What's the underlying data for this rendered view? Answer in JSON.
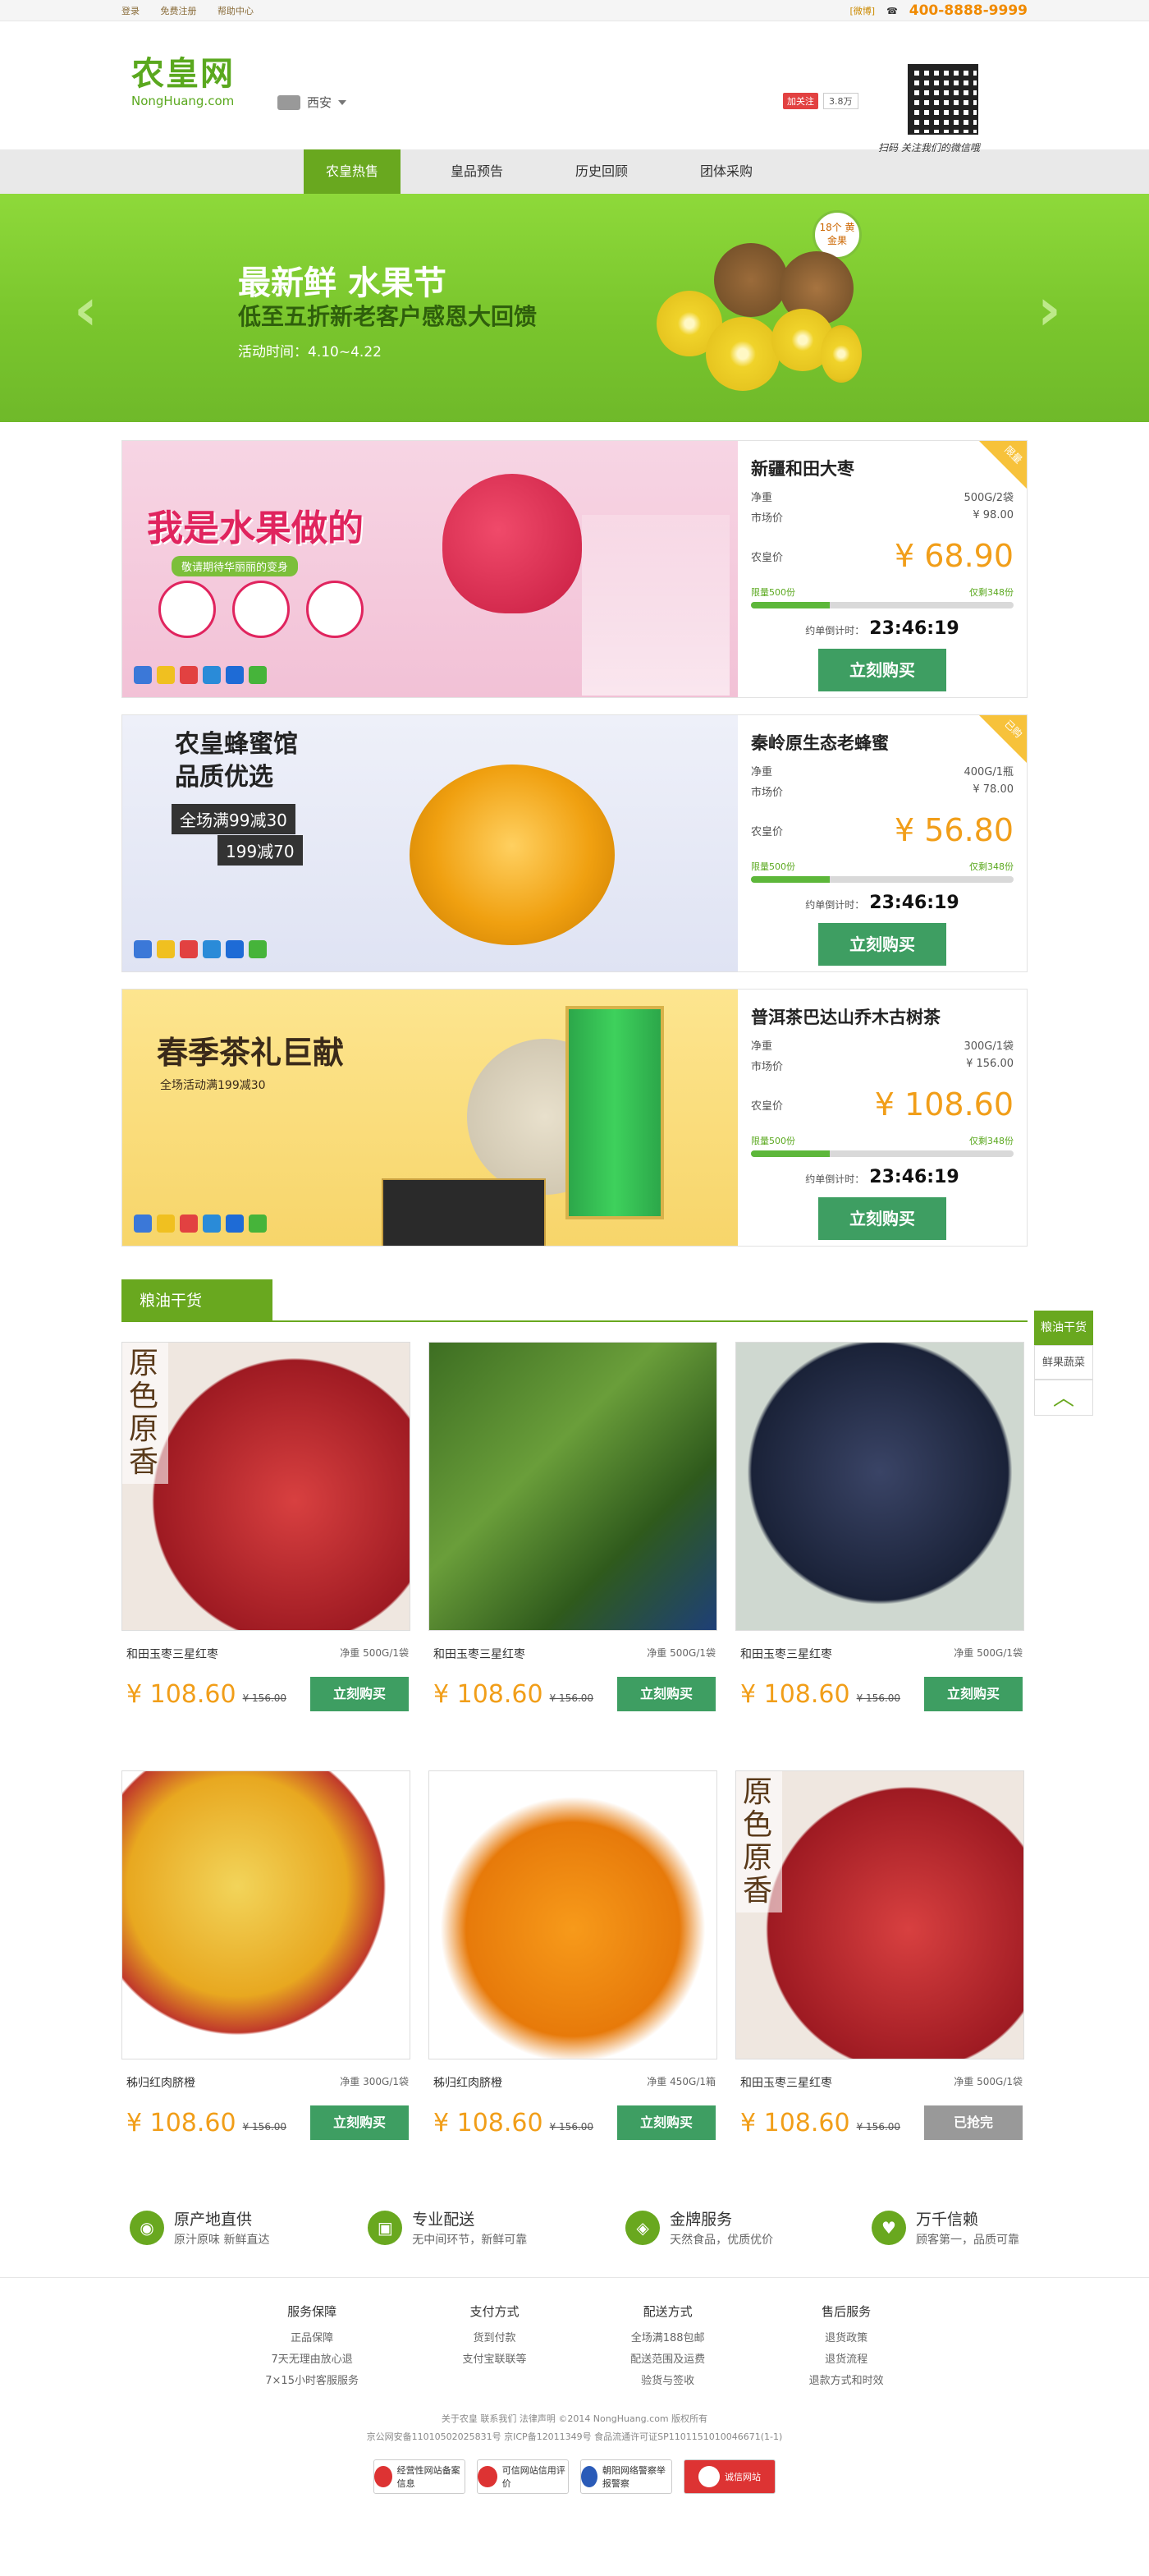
{
  "topbar": {
    "links": [
      "登录",
      "免费注册",
      "帮助中心"
    ],
    "weixin": "[微博]",
    "phone": "400-8888-9999"
  },
  "header": {
    "logo_cn": "农皇网",
    "logo_en": "NongHuang.com",
    "city": "西安",
    "weibo_follow": "加关注",
    "weibo_fans": "3.8万",
    "qr_note": "扫码  关注我们的微信哦"
  },
  "nav": {
    "items": [
      "农皇热售",
      "皇品预告",
      "历史回顾",
      "团体采购"
    ]
  },
  "banner": {
    "title": "最新鲜 水果节",
    "subtitle": "低至五折新老客户感恩大回馈",
    "time": "活动时间：4.10~4.22",
    "badge": "18个 黄金果"
  },
  "deals": [
    {
      "name": "新疆和田大枣",
      "spec_label": "净重",
      "spec": "500G/2袋",
      "market_label": "市场价",
      "market": "¥ 98.00",
      "price_label": "农皇价",
      "price": "¥ 68.90",
      "limit": "限量500份",
      "sold": "仅剩348份",
      "progress": 0.3,
      "timer_label": "约单倒计时：",
      "timer": "23:46:19",
      "buy": "立刻购买",
      "corner": "限量",
      "promo_title": "我是水果做的",
      "promo_sub": "敬请期待华丽丽的变身"
    },
    {
      "name": "秦岭原生态老蜂蜜",
      "spec_label": "净重",
      "spec": "400G/1瓶",
      "market_label": "市场价",
      "market": "¥ 78.00",
      "price_label": "农皇价",
      "price": "¥ 56.80",
      "limit": "限量500份",
      "sold": "仅剩348份",
      "progress": 0.3,
      "timer_label": "约单倒计时：",
      "timer": "23:46:19",
      "buy": "立刻购买",
      "corner": "已购",
      "promo_title": "农皇蜂蜜馆",
      "promo_title2": "品质优选",
      "promo_sub": "全场满99减30",
      "promo_sub2": "199减70"
    },
    {
      "name": "普洱茶巴达山乔木古树茶",
      "spec_label": "净重",
      "spec": "300G/1袋",
      "market_label": "市场价",
      "market": "¥ 156.00",
      "price_label": "农皇价",
      "price": "¥ 108.60",
      "limit": "限量500份",
      "sold": "仅剩348份",
      "progress": 0.3,
      "timer_label": "约单倒计时：",
      "timer": "23:46:19",
      "buy": "立刻购买",
      "promo_title": "春季茶礼巨献",
      "promo_sub": "全场活动满199减30"
    }
  ],
  "section": {
    "title": "粮油干货"
  },
  "products": [
    {
      "name": "和田玉枣三星红枣",
      "spec": "净重 500G/1袋",
      "price": "¥ 108.60",
      "old": "¥ 156.00",
      "btn": "立刻购买",
      "tag": "原色原香",
      "enabled": true
    },
    {
      "name": "和田玉枣三星红枣",
      "spec": "净重 500G/1袋",
      "price": "¥ 108.60",
      "old": "¥ 156.00",
      "btn": "立刻购买",
      "enabled": true
    },
    {
      "name": "和田玉枣三星红枣",
      "spec": "净重 500G/1袋",
      "price": "¥ 108.60",
      "old": "¥ 156.00",
      "btn": "立刻购买",
      "enabled": true
    },
    {
      "name": "秭归红肉脐橙",
      "spec": "净重 300G/1袋",
      "price": "¥ 108.60",
      "old": "¥ 156.00",
      "btn": "立刻购买",
      "enabled": true
    },
    {
      "name": "秭归红肉脐橙",
      "spec": "净重 450G/1箱",
      "price": "¥ 108.60",
      "old": "¥ 156.00",
      "btn": "立刻购买",
      "enabled": true
    },
    {
      "name": "和田玉枣三星红枣",
      "spec": "净重 500G/1袋",
      "price": "¥ 108.60",
      "old": "¥ 156.00",
      "btn": "已抢完",
      "tag": "原色原香",
      "enabled": false
    }
  ],
  "services": [
    {
      "title": "原产地直供",
      "desc": "原汁原味  新鲜直达",
      "icon": "globe-icon"
    },
    {
      "title": "专业配送",
      "desc": "无中间环节，新鲜可靠",
      "icon": "delivery-icon"
    },
    {
      "title": "金牌服务",
      "desc": "天然食品，优质优价",
      "icon": "medal-icon"
    },
    {
      "title": "万千信赖",
      "desc": "顾客第一，品质可靠",
      "icon": "heart-icon"
    }
  ],
  "footer": {
    "cols": [
      {
        "h": "服务保障",
        "items": [
          "正品保障",
          "7天无理由放心退",
          "7×15小时客服服务"
        ]
      },
      {
        "h": "支付方式",
        "items": [
          "货到付款",
          "支付宝联联等"
        ]
      },
      {
        "h": "配送方式",
        "items": [
          "全场满188包邮",
          "配送范围及运费",
          "验货与签收"
        ]
      },
      {
        "h": "售后服务",
        "items": [
          "退货政策",
          "退货流程",
          "退款方式和时效"
        ]
      }
    ],
    "links": "关于农皇  联系我们  法律声明  ©2014 NongHuang.com 版权所有",
    "icp": "京公网安备11010502025831号  京ICP备12011349号  食品流通许可证SP1101151010046671(1-1)",
    "certs": [
      "经营性网站备案信息",
      "可信网站信用评价",
      "朝阳网络警察举报警察",
      "诚信网站"
    ]
  },
  "float": {
    "a": "粮油干货",
    "b": "鲜果蔬菜",
    "top": "︿"
  },
  "colors": {
    "brand_green": "#69a81f",
    "buy_green": "#3e9e62",
    "price_orange": "#f19e19",
    "phone_orange": "#f08a00"
  }
}
